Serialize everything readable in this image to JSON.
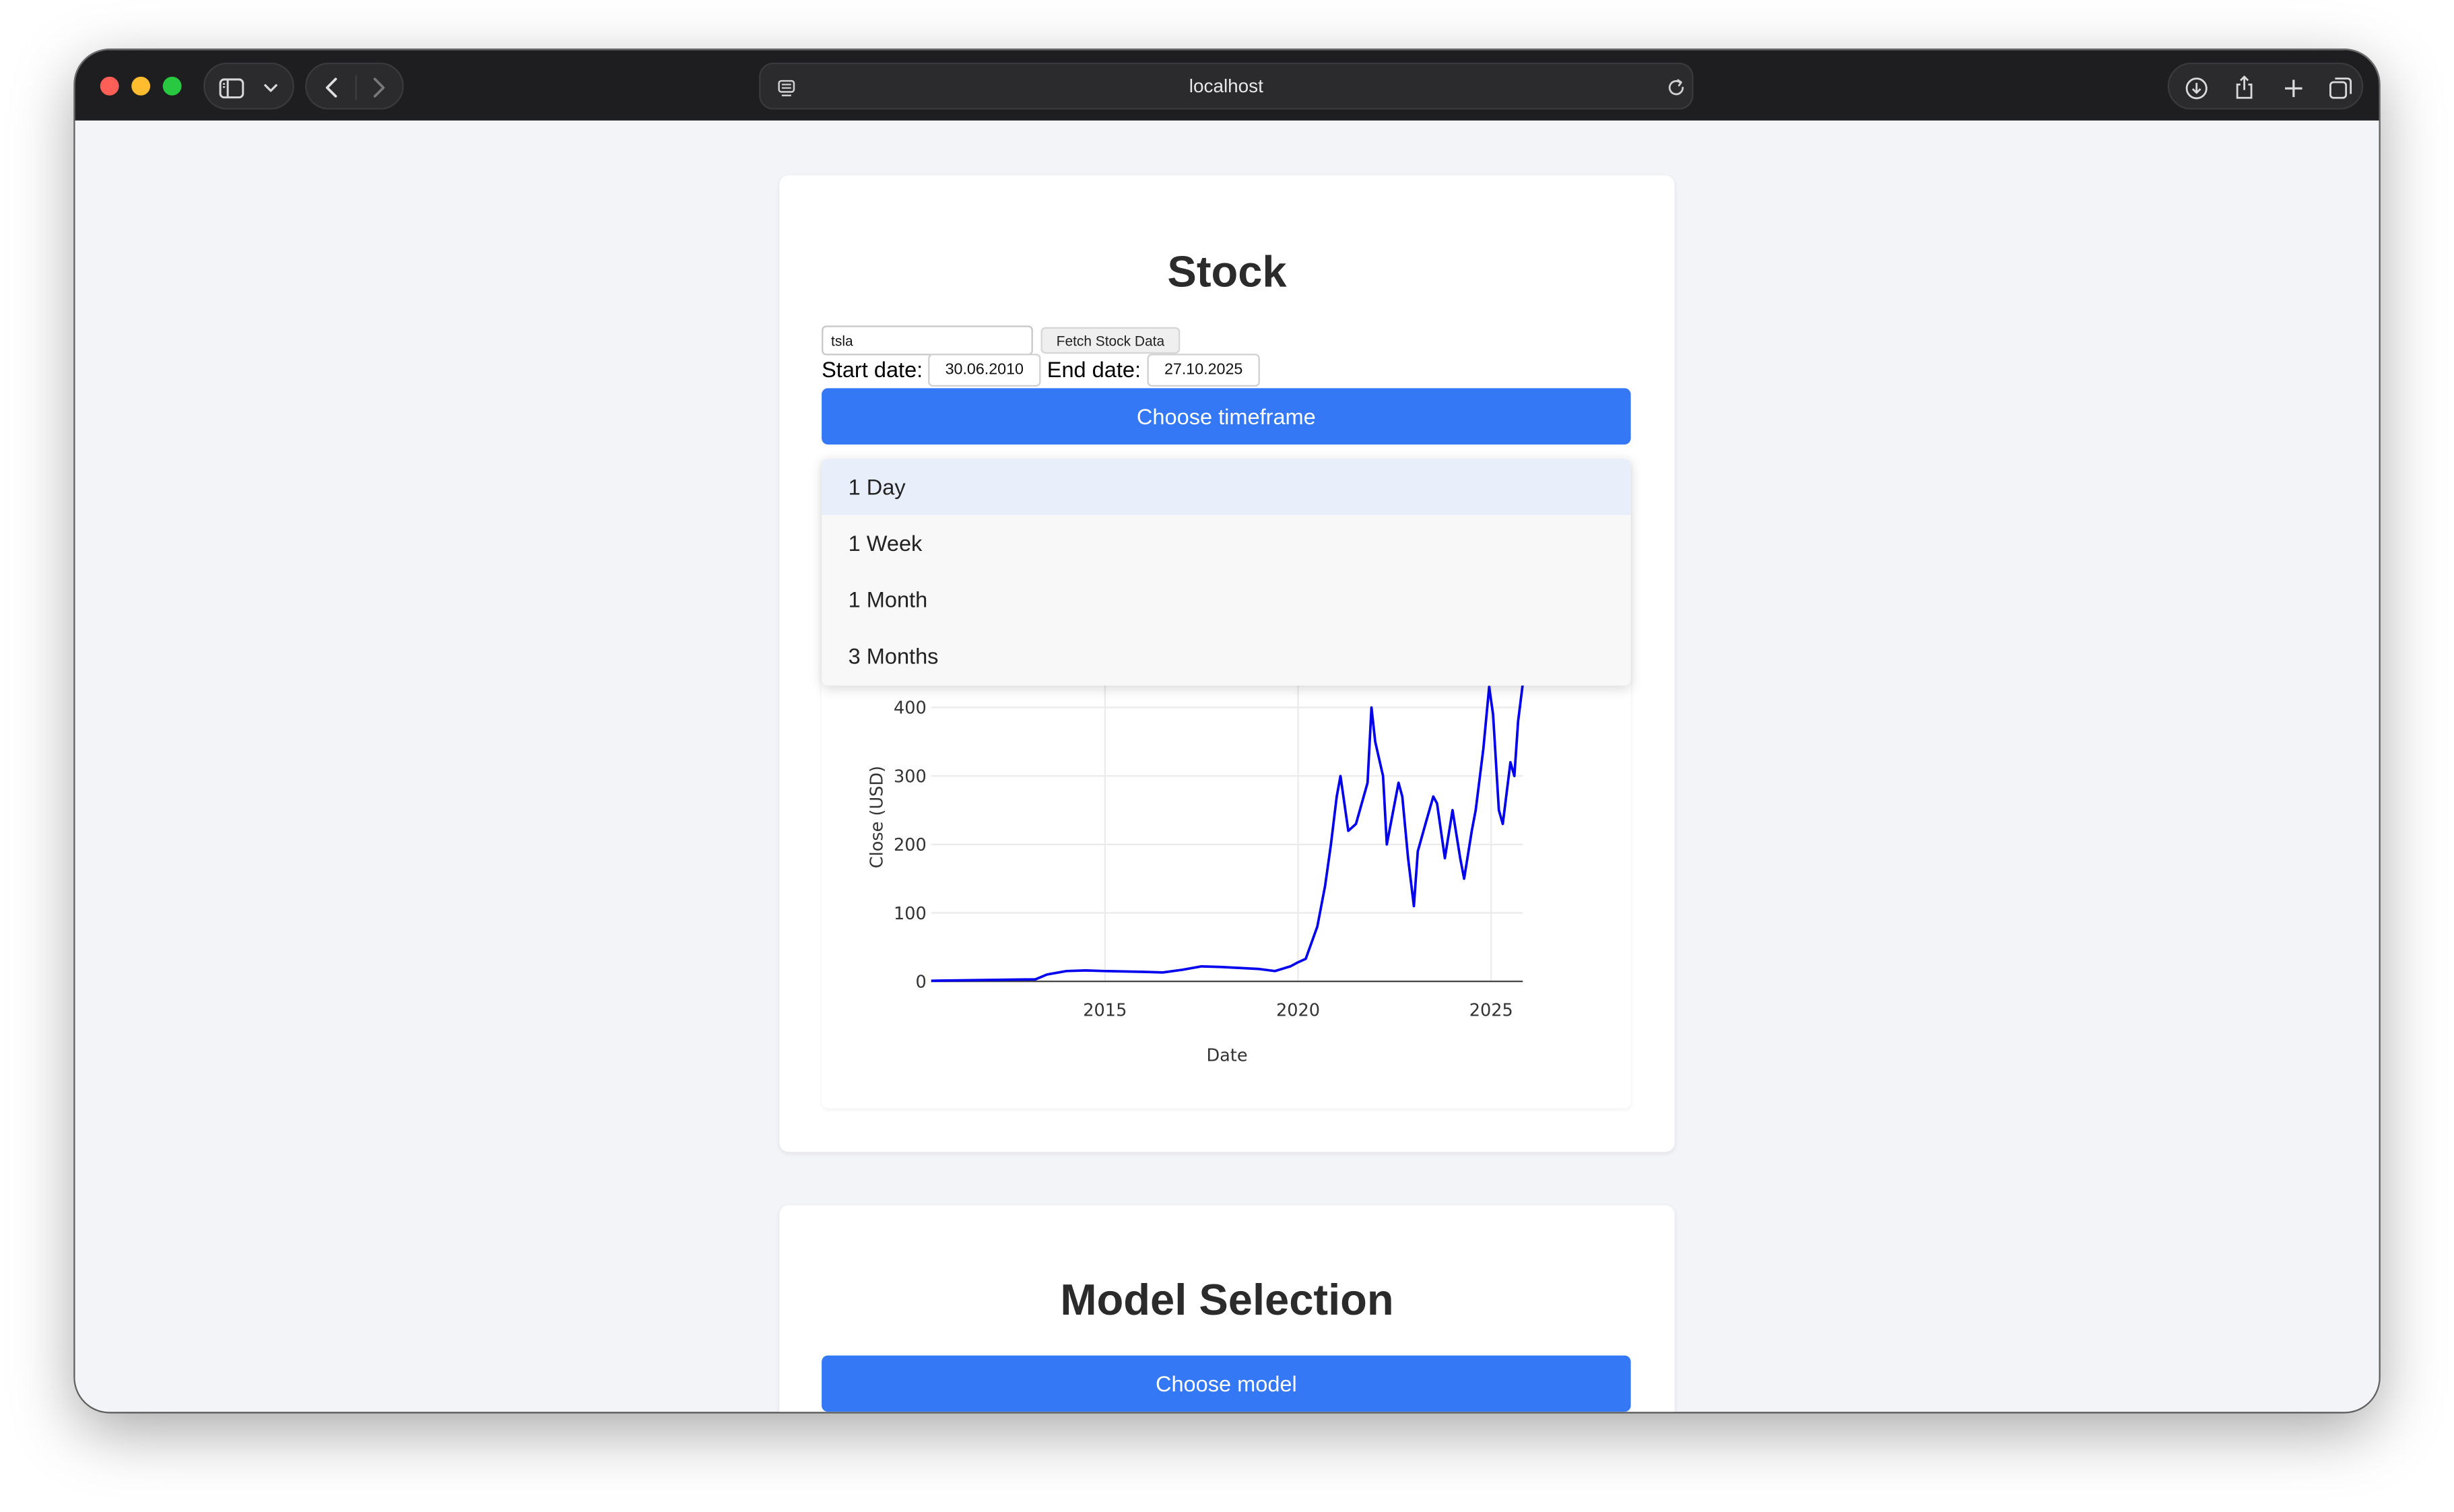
{
  "browser": {
    "url": "localhost",
    "traffic_light_colors": [
      "#ff5f57",
      "#febc2e",
      "#28c840"
    ]
  },
  "stock_card": {
    "title": "Stock",
    "ticker_value": "tsla",
    "fetch_button_label": "Fetch Stock Data",
    "start_date_label": "Start date:",
    "start_date_value": "30.06.2010",
    "end_date_label": "End date:",
    "end_date_value": "27.10.2025",
    "timeframe_button_label": "Choose timeframe",
    "timeframe_options": [
      "1 Day",
      "1 Week",
      "1 Month",
      "3 Months"
    ],
    "timeframe_selected": "1 Day"
  },
  "model_card": {
    "title": "Model Selection",
    "model_button_label": "Choose model"
  },
  "colors": {
    "accent": "#3478f6",
    "line": "#0000ee",
    "background": "#f3f4f8"
  },
  "chart_data": {
    "type": "line",
    "xlabel": "Date",
    "ylabel": "Close (USD)",
    "x_ticks": [
      "2015",
      "2020",
      "2025"
    ],
    "y_ticks": [
      "0",
      "100",
      "200",
      "300",
      "400"
    ],
    "xlim": [
      2010.5,
      2025.82
    ],
    "ylim_visible_top": 435,
    "grid": true,
    "series": [
      {
        "x": [
          2010.5,
          2013.2,
          2013.5,
          2014.0,
          2014.5,
          2015.0,
          2016.0,
          2016.5,
          2017.0,
          2017.5,
          2018.0,
          2019.0,
          2019.4,
          2019.8,
          2020.0,
          2020.2,
          2020.5,
          2020.7,
          2020.85,
          2021.0,
          2021.1,
          2021.3,
          2021.5,
          2021.8,
          2021.9,
          2022.0,
          2022.2,
          2022.3,
          2022.4,
          2022.6,
          2022.7,
          2022.85,
          2023.0,
          2023.1,
          2023.3,
          2023.5,
          2023.6,
          2023.8,
          2024.0,
          2024.2,
          2024.3,
          2024.5,
          2024.6,
          2024.8,
          2024.95,
          2025.05,
          2025.2,
          2025.3,
          2025.5,
          2025.6,
          2025.7,
          2025.82
        ],
        "y": [
          1,
          3,
          10,
          15,
          16,
          15,
          14,
          13,
          17,
          22,
          21,
          18,
          15,
          22,
          28,
          33,
          80,
          140,
          200,
          270,
          300,
          220,
          230,
          290,
          400,
          350,
          300,
          200,
          230,
          290,
          270,
          180,
          110,
          190,
          230,
          270,
          260,
          180,
          250,
          180,
          150,
          220,
          250,
          340,
          430,
          390,
          250,
          230,
          320,
          300,
          380,
          435
        ]
      }
    ]
  }
}
